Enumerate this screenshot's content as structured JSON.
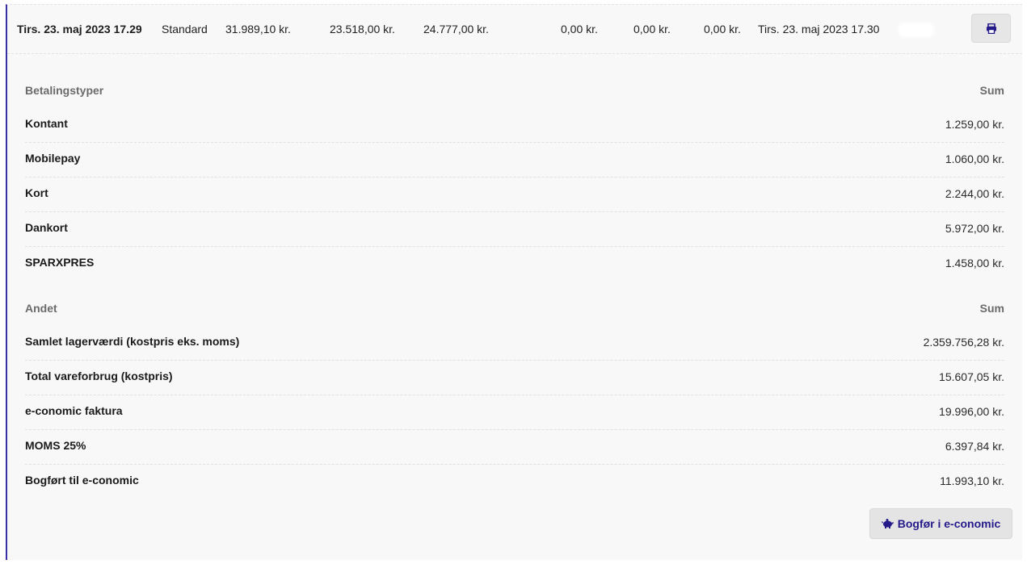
{
  "summary": {
    "date": "Tirs. 23. maj 2023 17.29",
    "type": "Standard",
    "amount1": "31.989,10 kr.",
    "amount2": "23.518,00 kr.",
    "amount3": "24.777,00 kr.",
    "amount4": "0,00 kr.",
    "amount5": "0,00 kr.",
    "amount6": "0,00 kr.",
    "closed_date": "Tirs. 23. maj 2023 17.30",
    "print_icon": "printer-icon"
  },
  "payment_section": {
    "header": "Betalingstyper",
    "sum_header": "Sum",
    "rows": [
      {
        "label": "Kontant",
        "value": "1.259,00 kr."
      },
      {
        "label": "Mobilepay",
        "value": "1.060,00 kr."
      },
      {
        "label": "Kort",
        "value": "2.244,00 kr."
      },
      {
        "label": "Dankort",
        "value": "5.972,00 kr."
      },
      {
        "label": "SPARXPRES",
        "value": "1.458,00 kr."
      }
    ]
  },
  "other_section": {
    "header": "Andet",
    "sum_header": "Sum",
    "rows": [
      {
        "label": "Samlet lagerværdi (kostpris eks. moms)",
        "value": "2.359.756,28 kr."
      },
      {
        "label": "Total vareforbrug (kostpris)",
        "value": "15.607,05 kr."
      },
      {
        "label": "e-conomic faktura",
        "value": "19.996,00 kr."
      },
      {
        "label": "MOMS 25%",
        "value": "6.397,84 kr."
      },
      {
        "label": "Bogført til e-conomic",
        "value": "11.993,10 kr."
      }
    ]
  },
  "actions": {
    "bogfor_label": "Bogfør i e-conomic",
    "bogfor_icon": "piggy-bank-icon"
  },
  "colors": {
    "accent": "#3a2fa6",
    "button_text": "#241a8a",
    "panel_bg": "#f8f8f8"
  }
}
